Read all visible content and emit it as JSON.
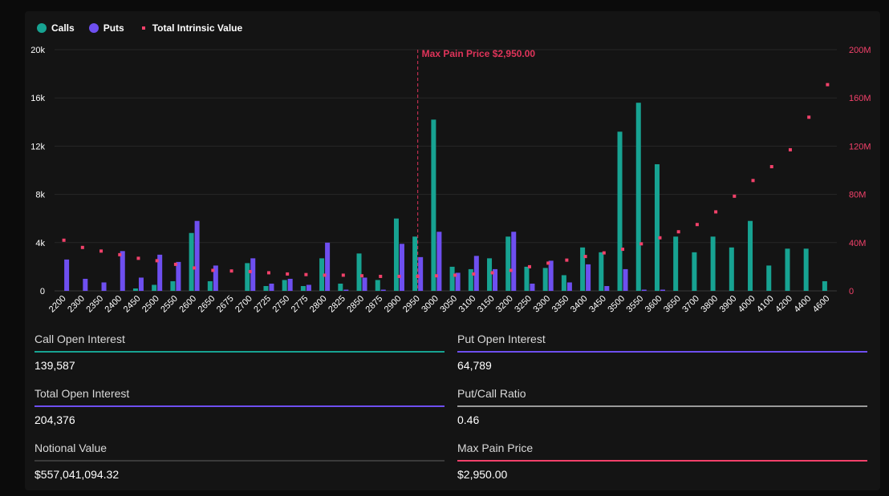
{
  "legend": {
    "calls_label": "Calls",
    "puts_label": "Puts",
    "tiv_label": "Total Intrinsic Value"
  },
  "colors": {
    "calls": "#17a392",
    "puts": "#6e4ff0",
    "tiv": "#f2416a",
    "max_pain": "#e0345a",
    "background": "#141414",
    "grid": "#262626"
  },
  "chart_data": {
    "type": "bar",
    "categories": [
      "2200",
      "2300",
      "2350",
      "2400",
      "2450",
      "2500",
      "2550",
      "2600",
      "2650",
      "2675",
      "2700",
      "2725",
      "2750",
      "2775",
      "2800",
      "2825",
      "2850",
      "2875",
      "2900",
      "2950",
      "3000",
      "3050",
      "3100",
      "3150",
      "3200",
      "3250",
      "3300",
      "3350",
      "3400",
      "3450",
      "3500",
      "3550",
      "3600",
      "3650",
      "3700",
      "3800",
      "3900",
      "4000",
      "4100",
      "4200",
      "4400",
      "4600"
    ],
    "series": [
      {
        "name": "Calls",
        "axis": "left",
        "values": [
          0,
          0,
          0,
          0,
          200,
          500,
          800,
          4800,
          800,
          0,
          2300,
          400,
          900,
          400,
          2700,
          600,
          3100,
          900,
          6000,
          4500,
          14200,
          2000,
          1800,
          2700,
          4500,
          2000,
          1900,
          1300,
          3600,
          3200,
          13200,
          15600,
          10500,
          4500,
          3200,
          4500,
          3600,
          5800,
          2100,
          3500,
          3500,
          800
        ]
      },
      {
        "name": "Puts",
        "axis": "left",
        "values": [
          2600,
          1000,
          700,
          3300,
          1100,
          3000,
          2400,
          5800,
          2100,
          0,
          2700,
          600,
          1000,
          500,
          4000,
          100,
          1100,
          100,
          3900,
          2800,
          4900,
          1500,
          2900,
          1800,
          4900,
          600,
          2500,
          700,
          2200,
          400,
          1800,
          100,
          100,
          0,
          0,
          0,
          0,
          0,
          0,
          0,
          0,
          0
        ]
      },
      {
        "name": "Total Intrinsic Value",
        "axis": "right",
        "type": "scatter",
        "values": [
          42000000,
          36000000,
          33000000,
          30000000,
          27000000,
          25000000,
          22000000,
          19000000,
          17000000,
          16500000,
          16000000,
          15000000,
          14000000,
          13500000,
          13000000,
          13000000,
          12500000,
          12000000,
          12000000,
          12000000,
          12500000,
          13000000,
          14000000,
          15000000,
          17000000,
          20000000,
          23000000,
          25500000,
          28500000,
          31500000,
          34500000,
          39000000,
          44000000,
          49000000,
          55000000,
          65500000,
          78500000,
          91500000,
          103000000,
          117000000,
          144000000,
          171000000
        ]
      }
    ],
    "y_left": {
      "range": [
        0,
        20000
      ],
      "ticks": [
        "0",
        "4k",
        "8k",
        "12k",
        "16k",
        "20k"
      ]
    },
    "y_right": {
      "range": [
        0,
        200000000
      ],
      "ticks": [
        "0",
        "40M",
        "80M",
        "120M",
        "160M",
        "200M"
      ]
    },
    "max_pain": {
      "category": "2950",
      "label": "Max Pain Price $2,950.00"
    },
    "grid": true,
    "legend_position": "top-left"
  },
  "stats": {
    "call_oi": {
      "label": "Call Open Interest",
      "value": "139,587",
      "color": "#17a392"
    },
    "put_oi": {
      "label": "Put Open Interest",
      "value": "64,789",
      "color": "#6e4ff0"
    },
    "total_oi": {
      "label": "Total Open Interest",
      "value": "204,376",
      "color": "#6e4ff0"
    },
    "pc_ratio": {
      "label": "Put/Call Ratio",
      "value": "0.46",
      "color": "#9a9a9a"
    },
    "notional": {
      "label": "Notional Value",
      "value": "$557,041,094.32",
      "color": "#3a3a3a"
    },
    "max_pain_price": {
      "label": "Max Pain Price",
      "value": "$2,950.00",
      "color": "#f2416a"
    }
  }
}
